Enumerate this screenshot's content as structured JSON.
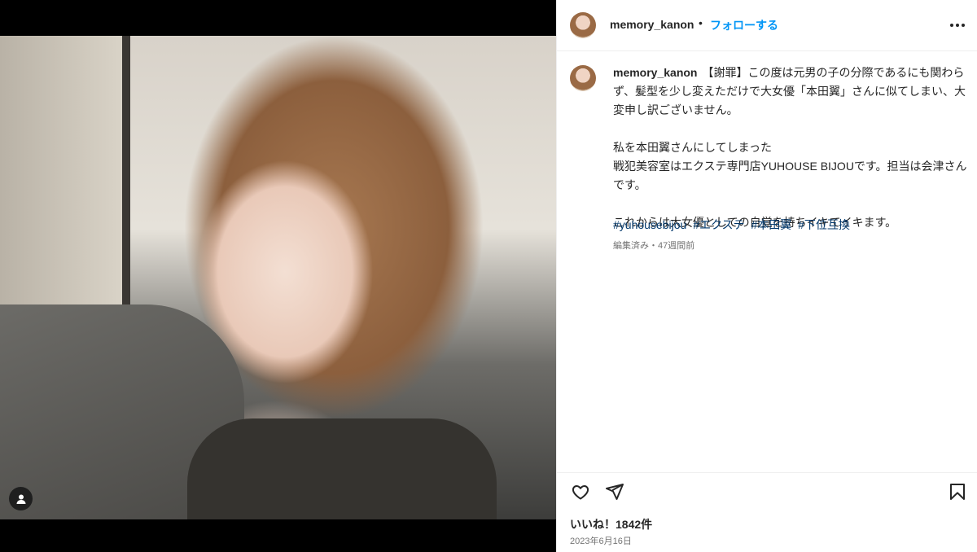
{
  "post": {
    "username": "memory_kanon",
    "follow_label": "フォローする",
    "separator": "•",
    "caption_lines": [
      "【謝罪】この度は元男の子の分際であるにも関わらず、髪型を少し変えただけで大女優「本田翼」さんに似てしまい、大変申し訳ございません。",
      "私を本田翼さんにしてしまった",
      "戦犯美容室はエクステ専門店YUHOUSE BIJOUです。担当は会津さんです。",
      "これからは大女優としての自覚を持ちイキてイキます。"
    ],
    "hashtags": [
      "#yuhousebijou",
      "#エクステ",
      "#本田翼",
      "#下位互換"
    ],
    "meta": "編集済み・47週間前",
    "likes": "いいね！1842件",
    "date": "2023年6月16日"
  },
  "icons": {
    "more": "more-options-icon",
    "like": "heart-icon",
    "share": "share-icon",
    "save": "bookmark-icon",
    "tag": "user-tag-icon"
  }
}
